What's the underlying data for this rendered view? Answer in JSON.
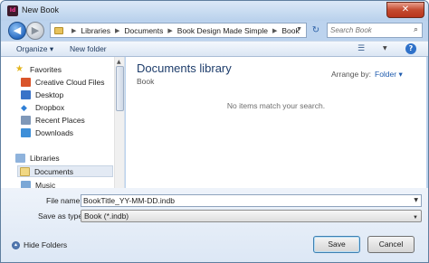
{
  "window": {
    "title": "New Book",
    "app_icon_text": "Id",
    "close_glyph": "✕"
  },
  "navbar": {
    "breadcrumbs": [
      "Libraries",
      "Documents",
      "Book Design Made Simple",
      "Book"
    ],
    "search_placeholder": "Search Book",
    "back_glyph": "◀",
    "forward_glyph": "▶",
    "refresh_glyph": "↻"
  },
  "toolbar": {
    "organize_label": "Organize ▾",
    "new_folder_label": "New folder",
    "views_glyph": "☰",
    "help_glyph": "?"
  },
  "nav_pane": {
    "favorites_header": "Favorites",
    "favorites": [
      "Creative Cloud Files",
      "Desktop",
      "Dropbox",
      "Recent Places",
      "Downloads"
    ],
    "libraries_header": "Libraries",
    "libraries": [
      "Documents",
      "Music"
    ],
    "selected": "Documents"
  },
  "content": {
    "library_title": "Documents library",
    "library_subtitle": "Book",
    "arrange_label": "Arrange by:",
    "arrange_value": "Folder ▾",
    "empty_message": "No items match your search."
  },
  "form": {
    "filename_label": "File name:",
    "filename_value": "BookTitle_YY-MM-DD.indb",
    "save_type_label": "Save as type:",
    "save_type_value": "Book (*.indb)",
    "hide_folders_label": "Hide Folders",
    "save_label": "Save",
    "cancel_label": "Cancel"
  },
  "colors": {
    "title_bar": "#c6dbf3",
    "close_button": "#c44a2f",
    "library_title": "#1e3d6b",
    "arrange_value": "#1f5cae",
    "app_icon": "#3d1b2c"
  }
}
